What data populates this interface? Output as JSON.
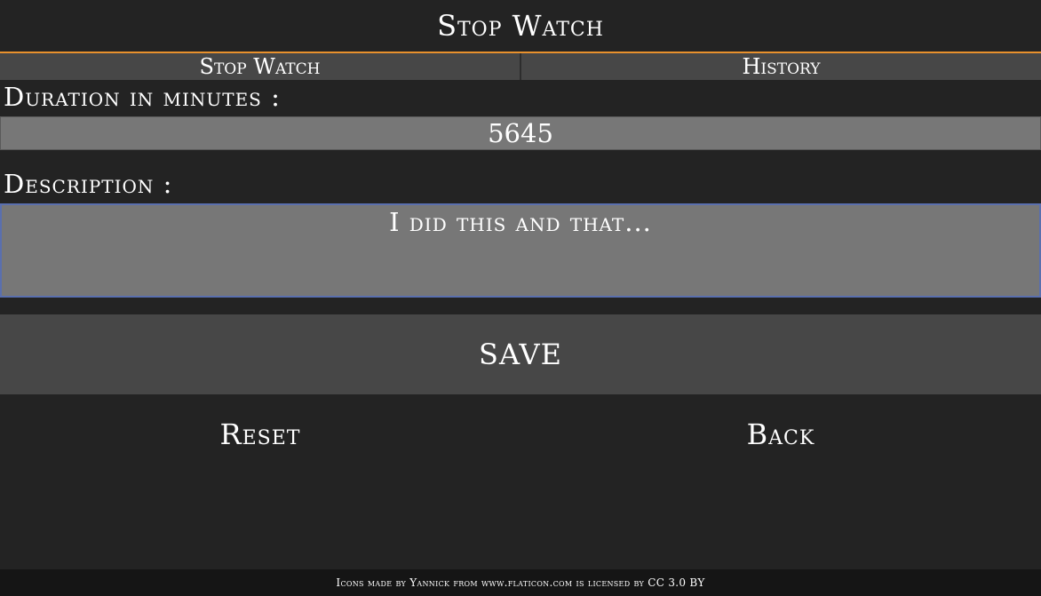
{
  "header": {
    "title": "Stop Watch"
  },
  "tabs": [
    {
      "label": "Stop Watch"
    },
    {
      "label": "History"
    }
  ],
  "form": {
    "duration_label": "Duration in minutes :",
    "duration_value": "5645",
    "description_label": "Description :",
    "description_value": "I did this and that..."
  },
  "actions": {
    "save_label": "SAVE",
    "reset_label": "Reset",
    "back_label": "Back"
  },
  "footer": {
    "text": "Icons made by Yannick from www.flaticon.com is licensed by CC 3.0 BY"
  },
  "colors": {
    "background": "#232323",
    "accent": "#e8912d",
    "tab_bg": "#474747",
    "input_bg": "#777777",
    "focus_border": "#5a6fae",
    "footer_bg": "#151515"
  }
}
